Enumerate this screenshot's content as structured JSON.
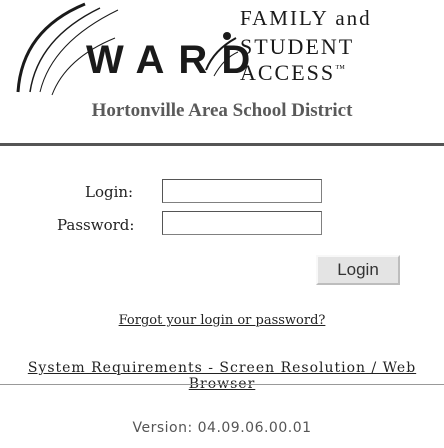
{
  "logo": {
    "brand_word": "WARD",
    "tagline_line1": "FAMILY and",
    "tagline_line2": "STUDENT",
    "tagline_line3": "ACCESS",
    "trademark": "™"
  },
  "district_name": "Hortonville Area School District",
  "form": {
    "login_label": "Login:",
    "login_value": "",
    "password_label": "Password:",
    "password_value": "",
    "button_label": "Login"
  },
  "links": {
    "forgot": "Forgot your login or password?",
    "system_requirements": "System Requirements - Screen Resolution / Web Browser"
  },
  "version": "Version: 04.09.06.00.01",
  "colors": {
    "text": "#222222",
    "district": "#5a5a5a",
    "rule": "#555555",
    "button_bg": "#e4e4e4"
  }
}
